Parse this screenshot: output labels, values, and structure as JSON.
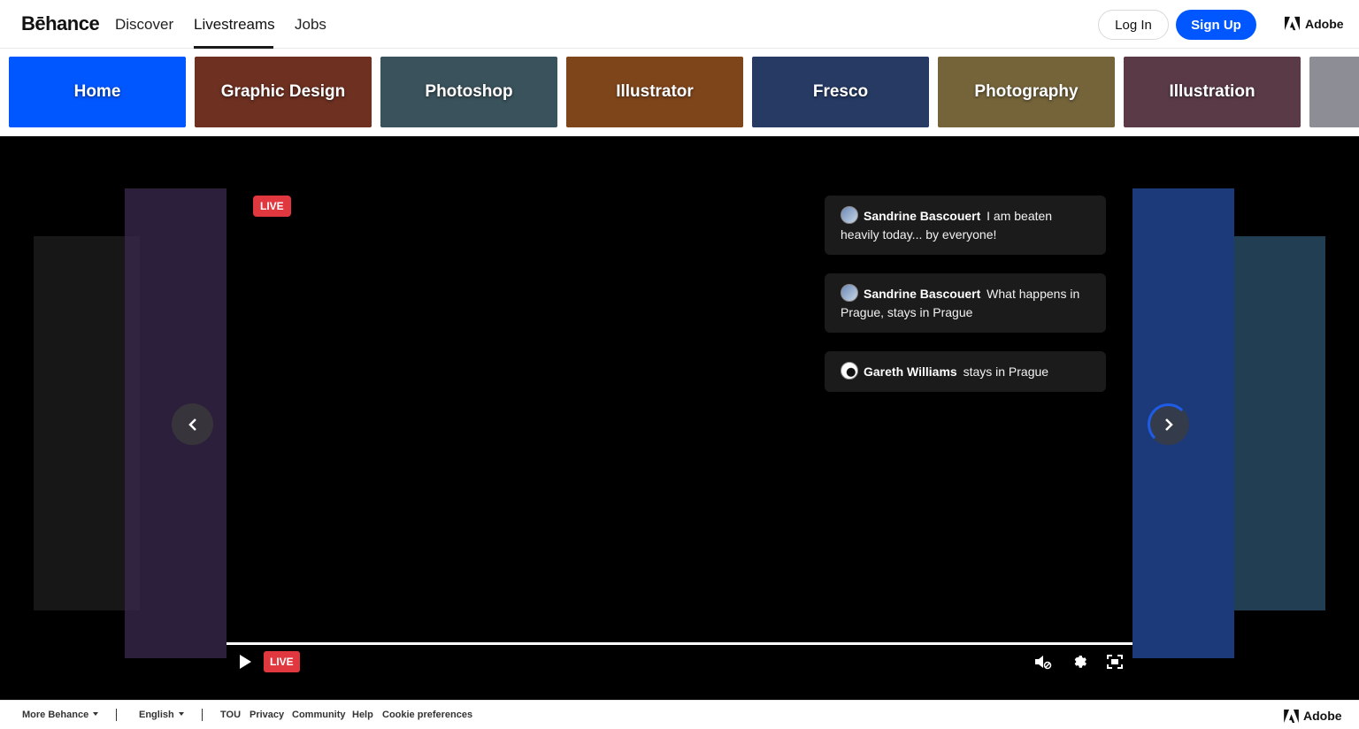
{
  "header": {
    "logo": "Bēhance",
    "nav": [
      "Discover",
      "Livestreams",
      "Jobs"
    ],
    "login": "Log In",
    "signup": "Sign Up",
    "brand": "Adobe"
  },
  "categories": [
    {
      "label": "Home",
      "color": "#0057ff"
    },
    {
      "label": "Graphic Design",
      "color": "#a84a34"
    },
    {
      "label": "Photoshop",
      "color": "#5a7e8c"
    },
    {
      "label": "Illustrator",
      "color": "#c26a2a"
    },
    {
      "label": "Fresco",
      "color": "#3b5a9a"
    },
    {
      "label": "Photography",
      "color": "#b49a5a"
    },
    {
      "label": "Illustration",
      "color": "#8a5a6e"
    }
  ],
  "player": {
    "live_badge": "LIVE",
    "control_live": "LIVE",
    "chat": [
      {
        "user": "Sandrine Bascouert",
        "text": "I am beaten heavily today... by everyone!"
      },
      {
        "user": "Sandrine Bascouert",
        "text": "What happens in Prague, stays in Prague"
      },
      {
        "user": "Gareth Williams",
        "text": "stays in Prague"
      }
    ]
  },
  "footer": {
    "more": "More Behance",
    "language": "English",
    "links": [
      "TOU",
      "Privacy",
      "Community",
      "Help",
      "Cookie preferences"
    ],
    "brand": "Adobe"
  }
}
